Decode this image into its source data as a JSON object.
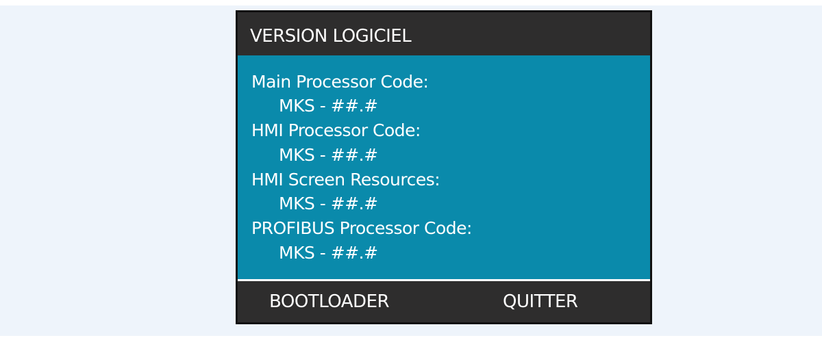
{
  "screen": {
    "title": "VERSION LOGICIEL",
    "entries": [
      {
        "label": "Main Processor Code:",
        "value": "MKS - ##.#"
      },
      {
        "label": "HMI Processor Code:",
        "value": "MKS - ##.#"
      },
      {
        "label": "HMI Screen Resources:",
        "value": "MKS - ##.#"
      },
      {
        "label": "PROFIBUS Processor Code:",
        "value": "MKS - ##.#"
      }
    ],
    "softkeys": {
      "left": "BOOTLOADER",
      "right": "QUITTER"
    }
  },
  "colors": {
    "background": "#eef4fb",
    "panel": "#2e2d2d",
    "content": "#0a8aab",
    "text": "#ffffff"
  }
}
